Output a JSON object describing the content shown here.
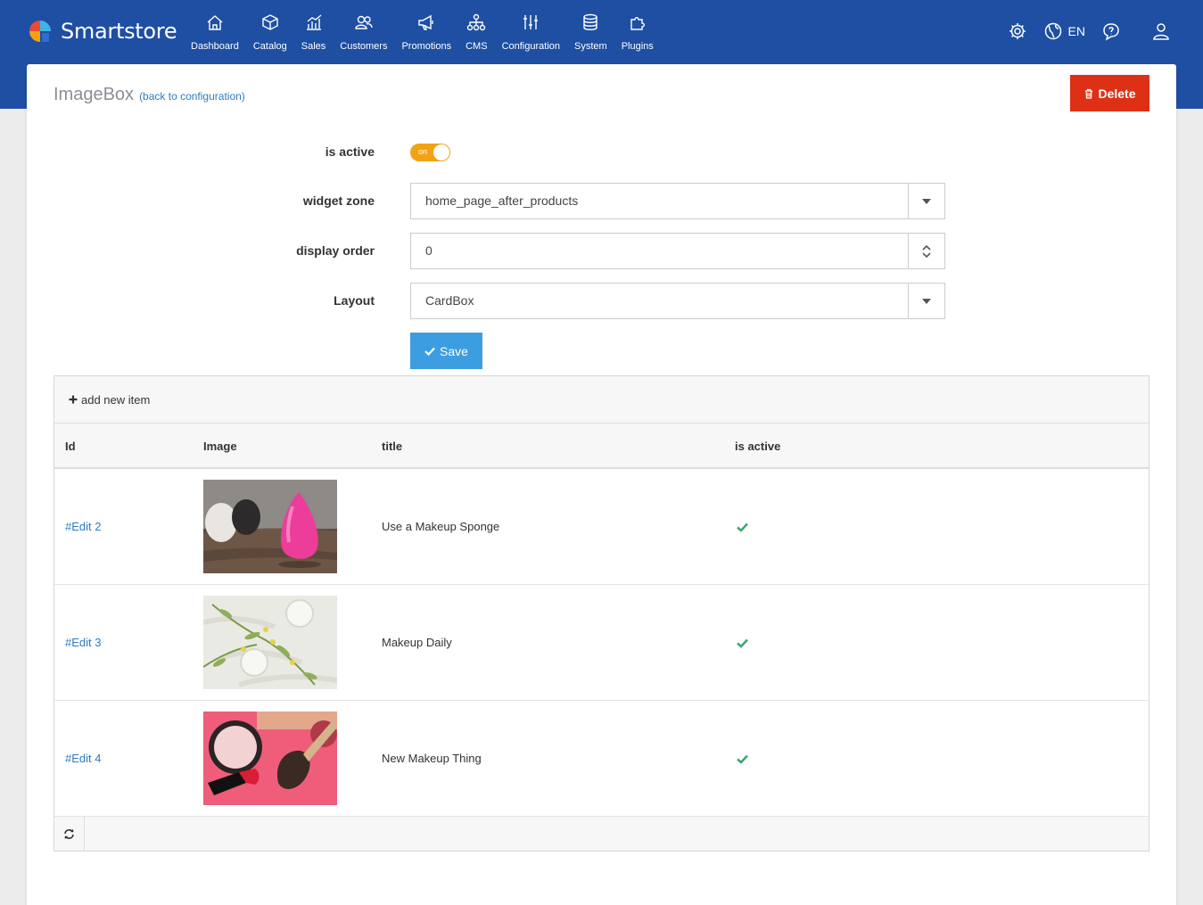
{
  "app": {
    "name": "Smartstore"
  },
  "nav": [
    {
      "label": "Dashboard",
      "icon": "home-icon"
    },
    {
      "label": "Catalog",
      "icon": "box-icon"
    },
    {
      "label": "Sales",
      "icon": "chart-icon"
    },
    {
      "label": "Customers",
      "icon": "users-icon"
    },
    {
      "label": "Promotions",
      "icon": "megaphone-icon"
    },
    {
      "label": "CMS",
      "icon": "sitemap-icon"
    },
    {
      "label": "Configuration",
      "icon": "sliders-icon"
    },
    {
      "label": "System",
      "icon": "database-icon"
    },
    {
      "label": "Plugins",
      "icon": "puzzle-icon"
    }
  ],
  "toolbar": {
    "language": "EN"
  },
  "page": {
    "title": "ImageBox",
    "back_link": "(back to configuration)",
    "delete_label": "Delete"
  },
  "form": {
    "is_active_label": "is active",
    "is_active_toggle": "on",
    "widget_zone_label": "widget zone",
    "widget_zone_value": "home_page_after_products",
    "display_order_label": "display order",
    "display_order_value": "0",
    "layout_label": "Layout",
    "layout_value": "CardBox",
    "save_label": "Save"
  },
  "grid": {
    "add_label": "add new item",
    "columns": {
      "id": "Id",
      "image": "Image",
      "title": "title",
      "active": "is active"
    },
    "rows": [
      {
        "id": "#Edit 2",
        "title": "Use a Makeup Sponge",
        "active": true
      },
      {
        "id": "#Edit 3",
        "title": "Makeup Daily",
        "active": true
      },
      {
        "id": "#Edit 4",
        "title": "New Makeup Thing",
        "active": true
      }
    ]
  },
  "colors": {
    "header": "#1e4fa3",
    "delete": "#dd3015",
    "save": "#3c9ee0",
    "toggle": "#f1a314",
    "check": "#3aa76d"
  }
}
